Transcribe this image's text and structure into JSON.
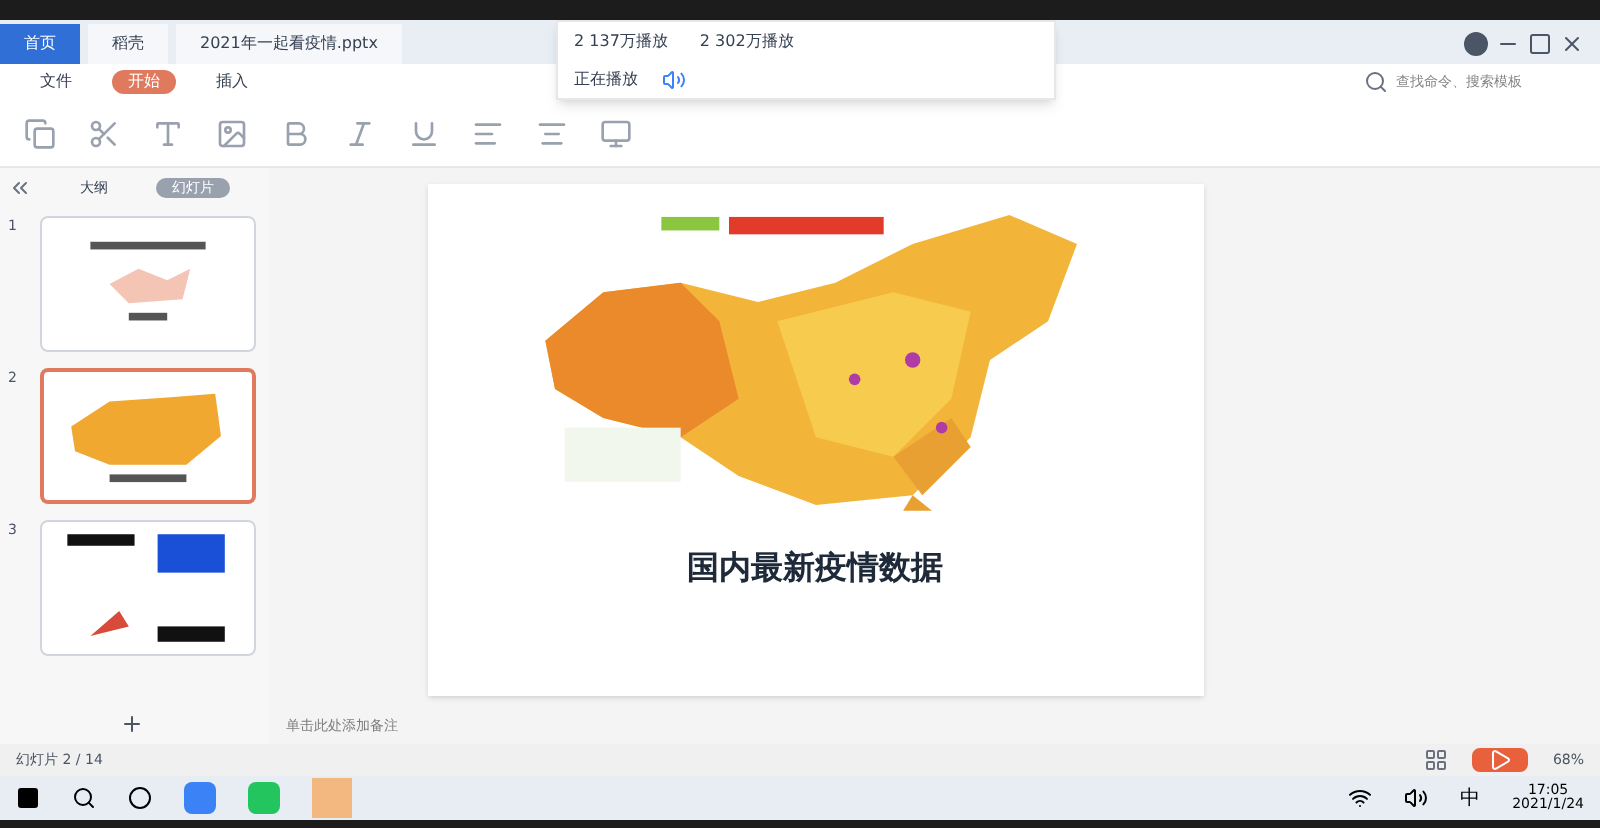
{
  "tabs": [
    {
      "label": "首页",
      "selected": true
    },
    {
      "label": "稻壳",
      "selected": false
    },
    {
      "label": "2021年一起看疫情.pptx",
      "selected": false
    }
  ],
  "popup": {
    "items": [
      "2 137万播放",
      "2 302万播放"
    ],
    "status": "正在播放"
  },
  "menu": [
    {
      "label": "文件",
      "selected": false
    },
    {
      "label": "开始",
      "selected": true
    },
    {
      "label": "插入",
      "selected": false
    }
  ],
  "search": {
    "placeholder": "查找命令、搜索模板"
  },
  "panel": {
    "tabs": [
      {
        "label": "大纲",
        "selected": false
      },
      {
        "label": "幻灯片",
        "selected": true
      }
    ],
    "slides": [
      {
        "number": "1",
        "selected": false
      },
      {
        "number": "2",
        "selected": true
      },
      {
        "number": "3",
        "selected": false
      }
    ]
  },
  "slide": {
    "caption": "国内最新疫情数据"
  },
  "notes": {
    "placeholder": "单击此处添加备注"
  },
  "status_bar": {
    "slide_count": "幻灯片 2 / 14",
    "zoom": "68%"
  },
  "taskbar": {
    "time": "17:05",
    "date": "2021/1/24",
    "ime": "中"
  }
}
